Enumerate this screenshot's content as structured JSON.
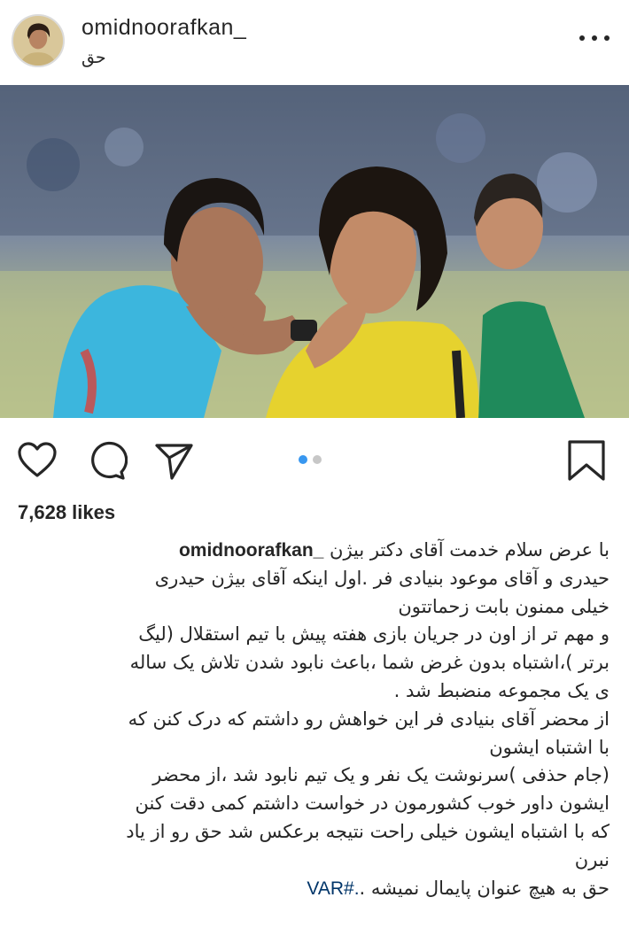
{
  "post": {
    "username": "omidnoorafkan_",
    "location": "حق",
    "likes": "7,628 likes"
  },
  "carousel": {
    "current": 1,
    "total": 2
  },
  "icons": {
    "avatar": "profile-photo",
    "more": "more-options-icon",
    "like": "heart-icon",
    "comment": "comment-bubble-icon",
    "share": "paper-plane-icon",
    "save": "bookmark-icon"
  },
  "colors": {
    "text": "#262626",
    "hashtag": "#003569",
    "dot_active": "#3897f0",
    "dot_inactive": "#c7c7c7"
  },
  "caption": {
    "username": "omidnoorafkan_",
    "line1": "با عرض سلام خدمت آقای دکتر بیژن",
    "line2": "حیدری و آقای موعود بنیادی فر .اول اینکه آقای بیژن حیدری",
    "line3": "خیلی ممنون بابت زحماتتون",
    "line4": "و مهم تر از اون در جریان بازی هفته پیش با تیم استقلال (لیگ",
    "line5": "برتر )،اشتباه بدون غرض شما ،باعث نابود شدن تلاش یک ساله",
    "line6": "ی یک مجموعه منضبط شد .",
    "line7": "از محضر آقای بنیادی فر این خواهش رو داشتم که درک کنن که",
    "line8": "با اشتباه ایشون",
    "line9": "(جام حذفی )سرنوشت یک نفر و یک تیم نابود شد ،از محضر",
    "line10": "ایشون داور خوب کشورمون در خواست داشتم کمی دقت کنن",
    "line11": "که با اشتباه ایشون خیلی راحت نتیجه برعکس شد حق رو از یاد",
    "line12": "نبرن",
    "line13": "حق به هیچ عنوان پایمال نمیشه .",
    "hashtag": "VAR#."
  }
}
